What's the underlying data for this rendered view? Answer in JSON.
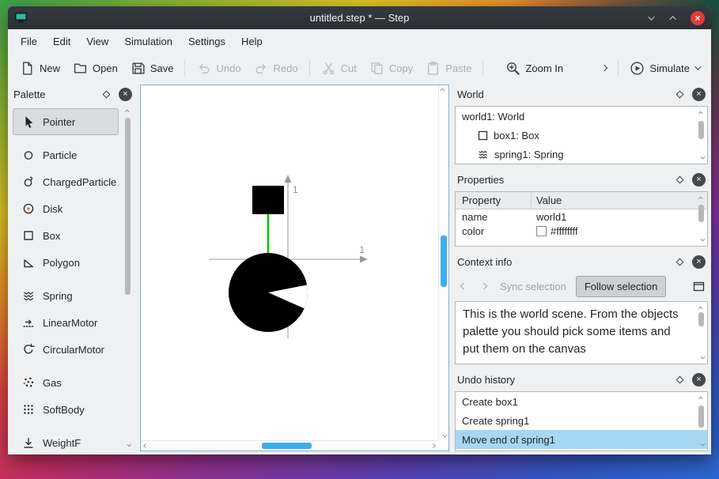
{
  "window": {
    "title": "untitled.step * — Step",
    "controls": {
      "close_glyph": "×"
    }
  },
  "menubar": {
    "items": [
      "File",
      "Edit",
      "View",
      "Simulation",
      "Settings",
      "Help"
    ]
  },
  "toolbar": {
    "new": "New",
    "open": "Open",
    "save": "Save",
    "undo": "Undo",
    "redo": "Redo",
    "cut": "Cut",
    "copy": "Copy",
    "paste": "Paste",
    "zoom_in": "Zoom In",
    "simulate": "Simulate"
  },
  "palette": {
    "title": "Palette",
    "items": [
      "Pointer",
      "Particle",
      "ChargedParticle",
      "Disk",
      "Box",
      "Polygon",
      "Spring",
      "LinearMotor",
      "CircularMotor",
      "Gas",
      "SoftBody",
      "WeightF"
    ]
  },
  "canvas": {
    "x_axis_tick": "1",
    "y_axis_tick": "1"
  },
  "world_panel": {
    "title": "World",
    "items": [
      "world1: World",
      "box1: Box",
      "spring1: Spring"
    ]
  },
  "properties_panel": {
    "title": "Properties",
    "columns": [
      "Property",
      "Value"
    ],
    "rows": [
      {
        "property": "name",
        "value": "world1"
      },
      {
        "property": "color",
        "value": "#ffffffff",
        "swatch": "#ffffff"
      }
    ]
  },
  "context_panel": {
    "title": "Context info",
    "sync_label": "Sync selection",
    "follow_label": "Follow selection",
    "body": "This is the world scene. From the objects palette you should pick some items and put them on the canvas"
  },
  "undo_panel": {
    "title": "Undo history",
    "items": [
      "Create box1",
      "Create spring1",
      "Move end of spring1"
    ],
    "selected": "Move end of spring1"
  },
  "colors": {
    "accent": "#3daee9",
    "selection_fill": "#a6d7f2",
    "spring_green": "#00c800",
    "titlebar": "#2c3136",
    "close_button": "#e23a3a"
  }
}
